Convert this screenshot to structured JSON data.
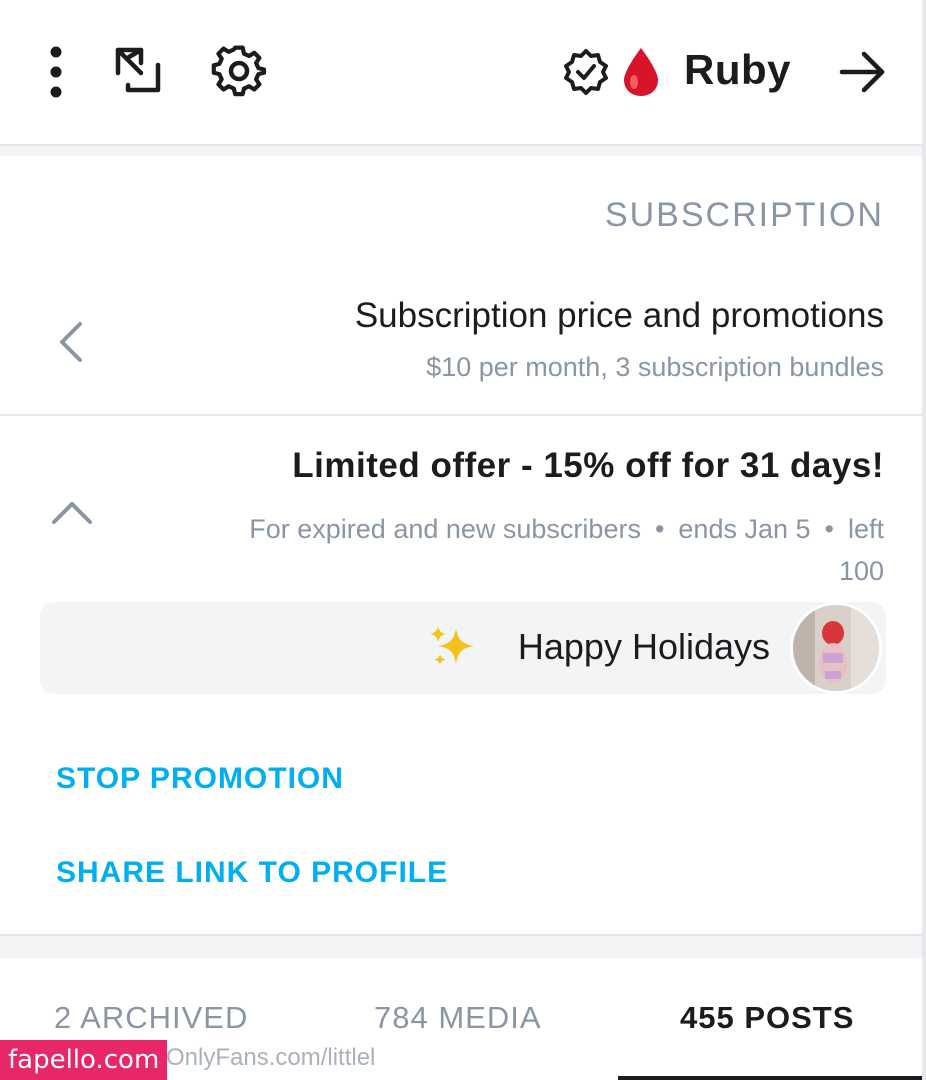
{
  "header": {
    "profile_name": "Ruby",
    "icons": {
      "back": "arrow-right-icon",
      "verified": "verified-badge-icon",
      "drop": "blood-drop-icon",
      "settings": "gear-icon",
      "share": "share-icon",
      "more": "more-vertical-icon"
    }
  },
  "subscription": {
    "section_title": "SUBSCRIPTION",
    "price_row": {
      "title": "Subscription price and promotions",
      "subtitle": "$10 per month, 3 subscription bundles"
    },
    "offer": {
      "title": "Limited offer - 15% off for 31 days!",
      "audience": "For expired and new subscribers",
      "ends": "ends Jan 5",
      "left": "left",
      "left_count": "100",
      "message": "Happy Holidays",
      "message_emoji": "✨"
    },
    "actions": {
      "stop_promotion": "STOP PROMOTION",
      "share_link": "SHARE LINK TO PROFILE"
    }
  },
  "tabs": [
    {
      "label": "455 POSTS",
      "active": true
    },
    {
      "label": "784 MEDIA",
      "active": false
    },
    {
      "label": "2 ARCHIVED",
      "active": false
    }
  ],
  "watermark": {
    "site": "fapello.com",
    "url": "OnlyFans.com/littlel"
  },
  "colors": {
    "accent": "#00aff0",
    "muted": "#8a96a3",
    "text": "#1c1c1e",
    "band": "#f2f4f6",
    "watermark_bg": "#e8266a"
  }
}
